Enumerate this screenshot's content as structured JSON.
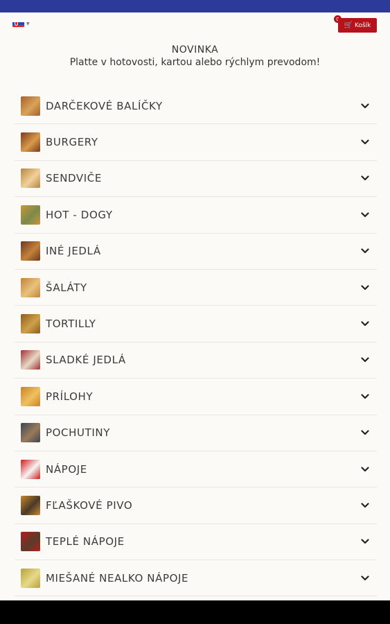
{
  "language": {
    "flag": "slovak-flag-icon"
  },
  "cart": {
    "label": "Košík",
    "count": "0",
    "icon": "cart-icon",
    "color": "#b5121b"
  },
  "header": {
    "title": "NOVINKA",
    "subtitle": "Platte v hotovosti, kartou alebo rýchlym prevodom!"
  },
  "categories": [
    {
      "label": "DARČEKOVÉ BALÍČKY",
      "icon": "food-thumbnail-icon",
      "c1": "#a8602a",
      "c2": "#d8a35a"
    },
    {
      "label": "BURGERY",
      "icon": "food-thumbnail-icon",
      "c1": "#7a3b1c",
      "c2": "#d99a4b"
    },
    {
      "label": "SENDVIČE",
      "icon": "food-thumbnail-icon",
      "c1": "#b7853f",
      "c2": "#f1d19a"
    },
    {
      "label": "HOT - DOGY",
      "icon": "food-thumbnail-icon",
      "c1": "#c9973c",
      "c2": "#7b8a4a"
    },
    {
      "label": "INÉ JEDLÁ",
      "icon": "food-thumbnail-icon",
      "c1": "#6b3a1b",
      "c2": "#c4813d"
    },
    {
      "label": "ŠALÁTY",
      "icon": "food-thumbnail-icon",
      "c1": "#c0843a",
      "c2": "#e8c27e"
    },
    {
      "label": "TORTILLY",
      "icon": "food-thumbnail-icon",
      "c1": "#8a5e20",
      "c2": "#cfa04a"
    },
    {
      "label": "SLADKÉ JEDLÁ",
      "icon": "food-thumbnail-icon",
      "c1": "#a03232",
      "c2": "#e7d8c6"
    },
    {
      "label": "PRÍLOHY",
      "icon": "food-thumbnail-icon",
      "c1": "#c88425",
      "c2": "#f0c060"
    },
    {
      "label": "POCHUTINY",
      "icon": "food-thumbnail-icon",
      "c1": "#3d4556",
      "c2": "#9a7b5a"
    },
    {
      "label": "NÁPOJE",
      "icon": "drink-thumbnail-icon",
      "c1": "#d01a1a",
      "c2": "#f4f4f4"
    },
    {
      "label": "FĽAŠKOVÉ PIVO",
      "icon": "beer-thumbnail-icon",
      "c1": "#c7872f",
      "c2": "#4a3a28"
    },
    {
      "label": "TEPLÉ NÁPOJE",
      "icon": "drink-thumbnail-icon",
      "c1": "#b01f1f",
      "c2": "#5b3b2a"
    },
    {
      "label": "MIEŠANÉ NEALKO NÁPOJE",
      "icon": "drink-thumbnail-icon",
      "c1": "#b9a13a",
      "c2": "#e6d98a"
    }
  ]
}
